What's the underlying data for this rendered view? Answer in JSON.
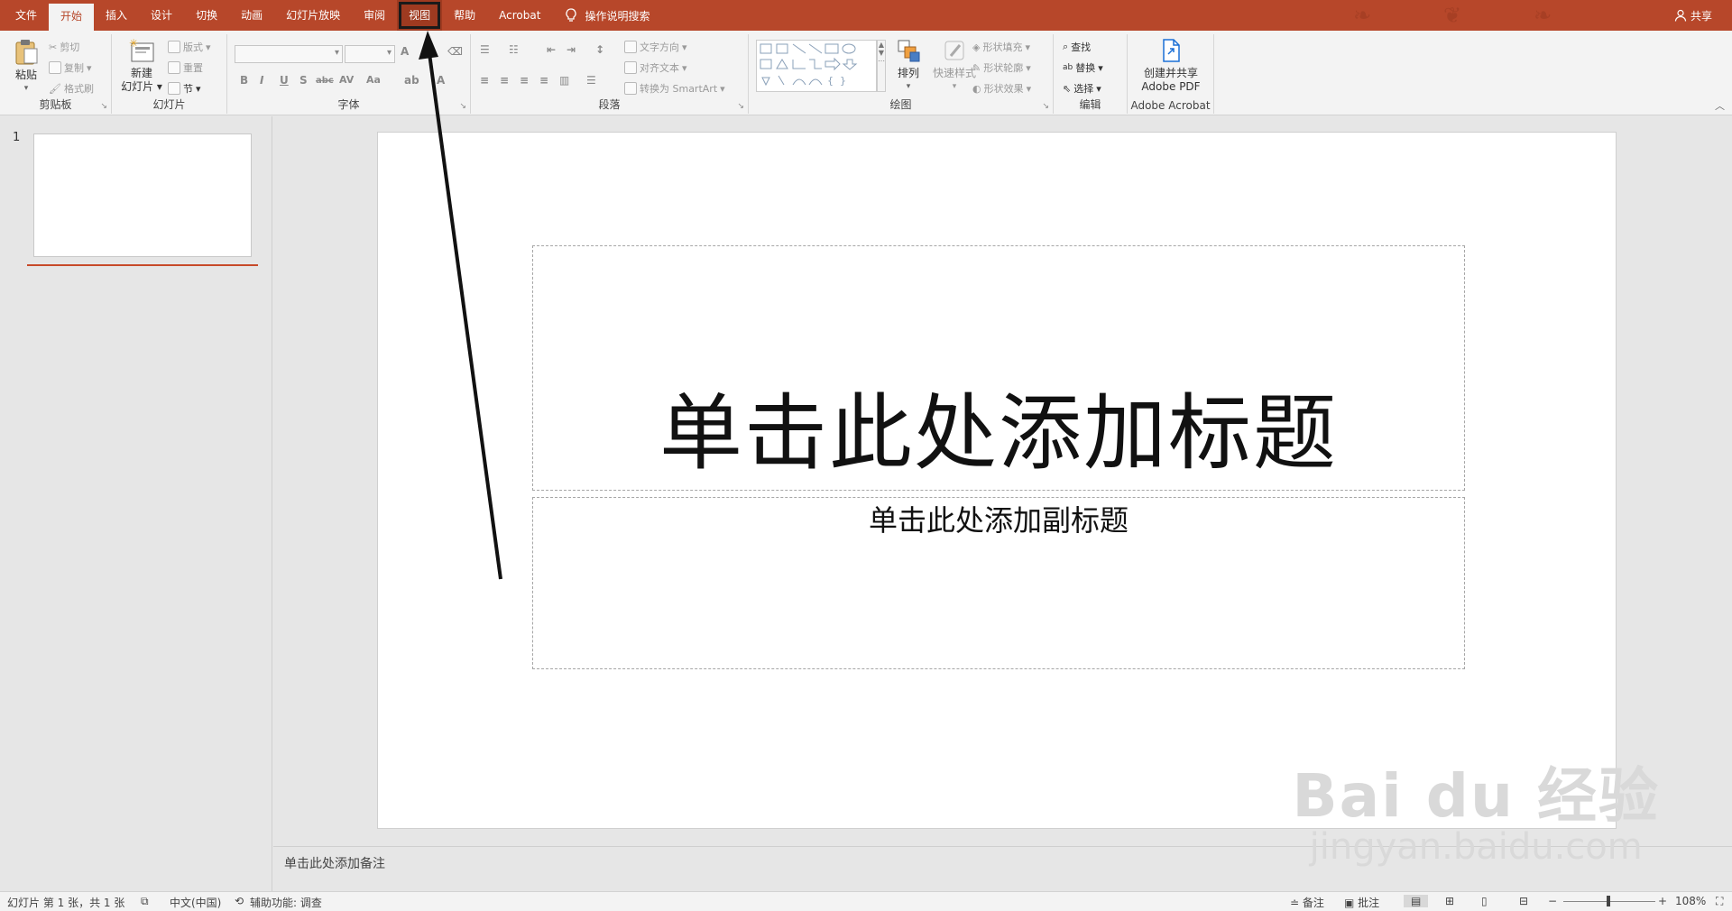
{
  "colors": {
    "accent": "#b7472a",
    "ribbon_bg": "#f3f3f3",
    "workspace_bg": "#e6e6e6",
    "highlight_box": "#1a1a1a"
  },
  "tabs": [
    {
      "label": "文件"
    },
    {
      "label": "开始",
      "active": true
    },
    {
      "label": "插入"
    },
    {
      "label": "设计"
    },
    {
      "label": "切换"
    },
    {
      "label": "动画"
    },
    {
      "label": "幻灯片放映"
    },
    {
      "label": "审阅"
    },
    {
      "label": "视图",
      "highlighted": true
    },
    {
      "label": "帮助"
    },
    {
      "label": "Acrobat"
    }
  ],
  "tell_me": {
    "label": "操作说明搜索",
    "icon": "lightbulb-icon"
  },
  "share": {
    "label": "共享",
    "icon": "person-icon"
  },
  "ribbon": {
    "clipboard": {
      "label": "剪贴板",
      "paste": "粘贴",
      "cut": "剪切",
      "copy": "复制",
      "format_painter": "格式刷"
    },
    "slides": {
      "label": "幻灯片",
      "new_slide_1": "新建",
      "new_slide_2": "幻灯片",
      "layout": "版式",
      "reset": "重置",
      "section": "节"
    },
    "font": {
      "label": "字体",
      "bold": "B",
      "italic": "I",
      "underline": "U",
      "shadow": "S",
      "strike": "abc",
      "spacing": "AV",
      "case": "Aa",
      "grow": "A",
      "shrink": "A"
    },
    "paragraph": {
      "label": "段落",
      "text_direction": "文字方向",
      "align_text": "对齐文本",
      "smartart": "转换为 SmartArt"
    },
    "drawing": {
      "label": "绘图",
      "arrange": "排列",
      "quick_styles": "快速样式",
      "shape_fill": "形状填充",
      "shape_outline": "形状轮廓",
      "shape_effects": "形状效果"
    },
    "editing": {
      "label": "编辑",
      "find": "查找",
      "replace": "替换",
      "select": "选择"
    },
    "acrobat": {
      "label": "Adobe Acrobat",
      "create_1": "创建并共享",
      "create_2": "Adobe PDF"
    }
  },
  "thumbnails": {
    "slide_number": "1"
  },
  "slide": {
    "title_placeholder": "单击此处添加标题",
    "subtitle_placeholder": "单击此处添加副标题"
  },
  "notes": {
    "placeholder": "单击此处添加备注"
  },
  "status": {
    "slide_info": "幻灯片 第 1 张，共 1 张",
    "language": "中文(中国)",
    "accessibility": "辅助功能: 调查",
    "notes_btn": "备注",
    "comments_btn": "批注",
    "zoom": "108%"
  },
  "watermark": {
    "main": "Bai du 经验",
    "sub": "jingyan.baidu.com"
  }
}
